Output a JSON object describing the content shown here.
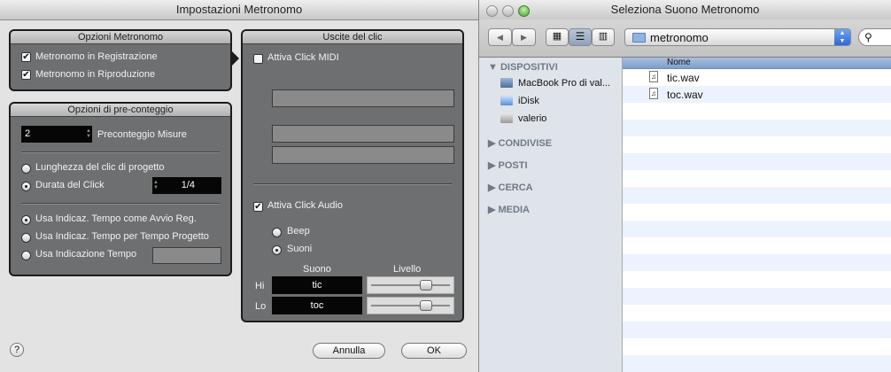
{
  "metronome_window": {
    "title": "Impostazioni Metronomo",
    "options": {
      "title": "Opzioni Metronomo",
      "record": "Metronomo in Registrazione",
      "play": "Metronomo in Riproduzione",
      "record_checked": true,
      "play_checked": true
    },
    "precount": {
      "title": "Opzioni di pre-conteggio",
      "bars_value": "2",
      "bars_label": "Preconteggio Misure",
      "radio_project": "Lunghezza del clic di progetto",
      "radio_duration": "Durata del Click",
      "duration_value": "1/4",
      "radio_tempo_start": "Usa Indicaz. Tempo come Avvio Reg.",
      "radio_tempo_project": "Usa Indicaz. Tempo per Tempo Progetto",
      "radio_tempo": "Usa Indicazione Tempo"
    },
    "outputs": {
      "title": "Uscite del clic",
      "midi": "Attiva Click MIDI",
      "midi_checked": false,
      "audio": "Attiva Click Audio",
      "audio_checked": true,
      "beep": "Beep",
      "sounds": "Suoni",
      "col_sound": "Suono",
      "col_level": "Livello",
      "hi_label": "Hi",
      "hi_sound": "tic",
      "hi_level": 0.73,
      "lo_label": "Lo",
      "lo_sound": "toc",
      "lo_level": 0.73
    },
    "buttons": {
      "cancel": "Annulla",
      "ok": "OK",
      "help": "?"
    }
  },
  "finder_window": {
    "title": "Seleziona Suono Metronomo",
    "path": "metronomo",
    "sidebar": {
      "devices": "DISPOSITIVI",
      "items": [
        "MacBook Pro di val...",
        "iDisk",
        "valerio"
      ],
      "shared": "CONDIVISE",
      "places": "POSTI",
      "search": "CERCA",
      "media": "MEDIA"
    },
    "column_name": "Nome",
    "files": [
      "tic.wav",
      "toc.wav"
    ]
  },
  "colors": {
    "panel": "#6e6f70",
    "selection_header": "#7f9ecb",
    "alt_row": "#edf3fe"
  }
}
